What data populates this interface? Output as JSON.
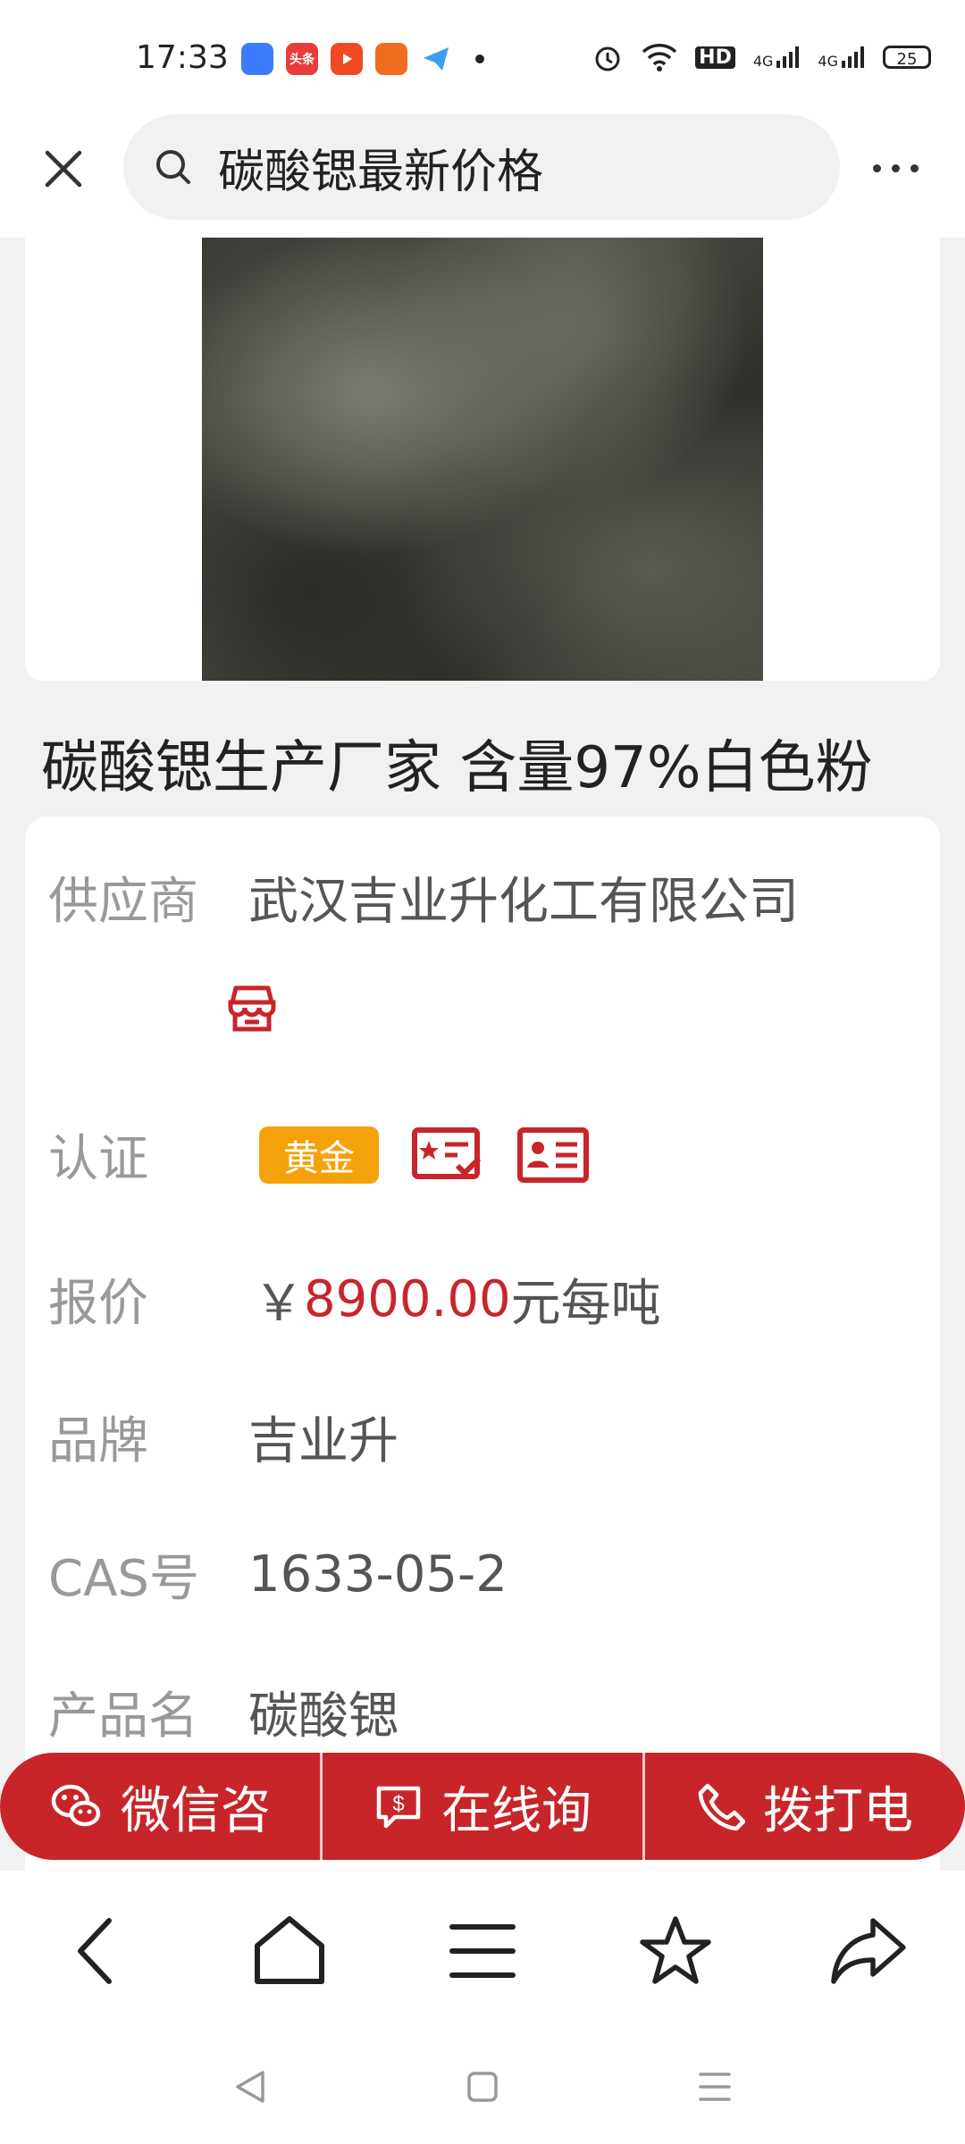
{
  "status_bar": {
    "time": "17:33",
    "apps": [
      {
        "icon": "browser-app-icon",
        "color": "#3d7bfd",
        "label": ""
      },
      {
        "icon": "toutiao-app-icon",
        "color": "#e93b3b",
        "label": "头条"
      },
      {
        "icon": "video-app-icon",
        "color": "#f04a23",
        "label": ""
      },
      {
        "icon": "gift-app-icon",
        "color": "#f26c1f",
        "label": ""
      },
      {
        "icon": "telegram-app-icon",
        "color": "#3aa0f0",
        "label": ""
      }
    ],
    "network_hd": "HD",
    "signal_1": "4G",
    "signal_2": "4G",
    "battery": "25"
  },
  "header": {
    "search_query": "碳酸锶最新价格"
  },
  "product": {
    "title": "碳酸锶生产厂家 含量97%白色粉"
  },
  "info": {
    "supplier_label": "供应商",
    "supplier_value": "武汉吉业升化工有限公司",
    "cert_label": "认证",
    "cert_badge": "黄金",
    "price_label": "报价",
    "price_symbol": "￥",
    "price_value": "8900.00",
    "price_unit": "元每吨",
    "brand_label": "品牌",
    "brand_value": "吉业升",
    "cas_label": "CAS号",
    "cas_value": "1633-05-2",
    "product_name_label": "产品名",
    "product_name_value": "碳酸锶"
  },
  "actions": {
    "wechat": "微信咨",
    "online": "在线询",
    "call": "拨打电"
  },
  "colors": {
    "accent_red": "#c8252b",
    "gold": "#f5a20a"
  }
}
